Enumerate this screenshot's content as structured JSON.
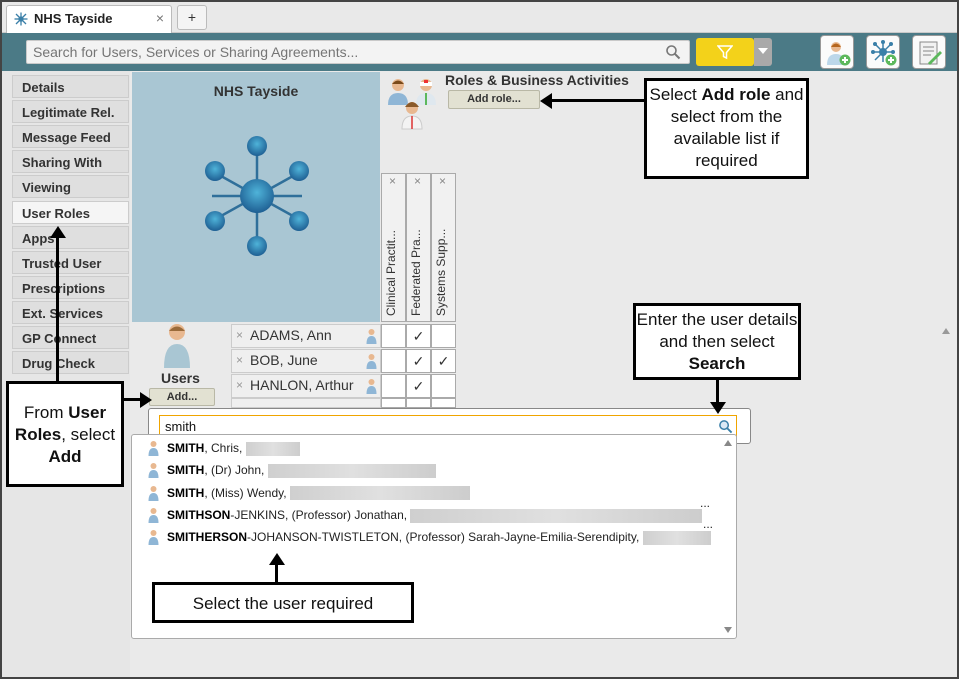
{
  "tab": {
    "title": "NHS Tayside",
    "close": "×",
    "new_tab": "+"
  },
  "toolbar": {
    "search_placeholder": "Search for Users, Services or Sharing Agreements...",
    "icons": [
      "search-icon",
      "filter-icon",
      "add-user-icon",
      "add-network-icon",
      "edit-document-icon"
    ]
  },
  "sidebar": {
    "items": [
      "Details",
      "Legitimate Rel.",
      "Message Feed",
      "Sharing With",
      "Viewing",
      "User Roles",
      "Apps",
      "Trusted User",
      "Prescriptions",
      "Ext. Services",
      "GP Connect",
      "Drug Check"
    ],
    "active": "User Roles"
  },
  "org": {
    "title": "NHS Tayside"
  },
  "roles": {
    "title": "Roles & Business Activities",
    "add_label": "Add role...",
    "columns": [
      "Clinical Practit...",
      "Federated Pra...",
      "Systems Supp..."
    ],
    "remove_glyph": "×"
  },
  "users": {
    "label": "Users",
    "add_label": "Add...",
    "rows": [
      {
        "name": "ADAMS, Ann",
        "checks": [
          "",
          "✓",
          ""
        ]
      },
      {
        "name": "BOB, June",
        "checks": [
          "",
          "✓",
          "✓"
        ]
      },
      {
        "name": "HANLON, Arthur",
        "checks": [
          "",
          "✓",
          ""
        ]
      }
    ]
  },
  "user_search": {
    "value": "smith",
    "results": [
      {
        "bold": "SMITH",
        "rest": ", Chris,"
      },
      {
        "bold": "SMITH",
        "rest": ", (Dr) John,"
      },
      {
        "bold": "SMITH",
        "rest": ", (Miss) Wendy,"
      },
      {
        "bold": "SMITHSON",
        "rest": "-JENKINS, (Professor) Jonathan,"
      },
      {
        "bold": "SMITHERSON",
        "rest": "-JOHANSON-TWISTLETON, (Professor) Sarah-Jayne-Emilia-Serendipity,"
      }
    ],
    "ellipsis": "..."
  },
  "callouts": {
    "add_role": {
      "pre": "Select ",
      "bold": "Add role",
      "post": " and select from the available list if required"
    },
    "search": {
      "pre": "Enter the user details and then select ",
      "bold": "Search"
    },
    "user_roles": {
      "pre": "From ",
      "bold1": "User Roles",
      "mid": ", select ",
      "bold2": "Add"
    },
    "select_user": {
      "text": "Select the user required"
    }
  },
  "colors": {
    "toolbar": "#4b7a86",
    "filter": "#f3d21a",
    "org_panel": "#a9c6d3"
  }
}
